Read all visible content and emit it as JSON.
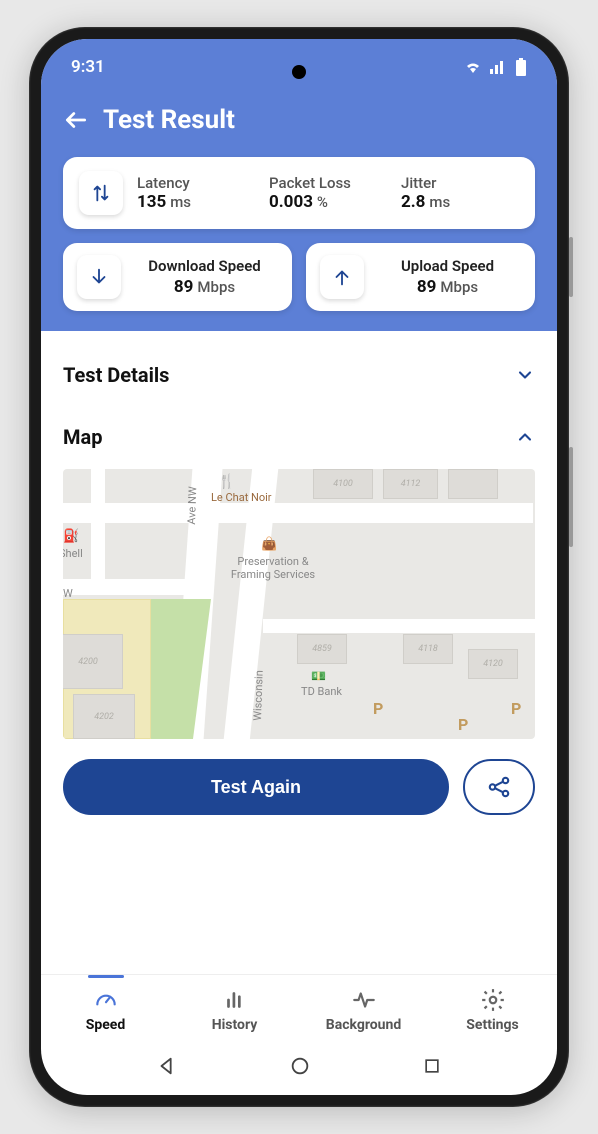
{
  "status": {
    "time": "9:31"
  },
  "header": {
    "title": "Test Result"
  },
  "stats": {
    "latency_label": "Latency",
    "latency_value": "135",
    "latency_unit": "ms",
    "packetloss_label": "Packet Loss",
    "packetloss_value": "0.003",
    "packetloss_unit": "%",
    "jitter_label": "Jitter",
    "jitter_value": "2.8",
    "jitter_unit": "ms"
  },
  "speed": {
    "download_label": "Download Speed",
    "download_value": "89",
    "download_unit": "Mbps",
    "upload_label": "Upload Speed",
    "upload_value": "89",
    "upload_unit": "Mbps"
  },
  "sections": {
    "details_title": "Test Details",
    "map_title": "Map"
  },
  "map": {
    "road1": "Ave NW",
    "road2": "Wisconsin",
    "poi1": "Le Chat Noir",
    "poi2": "Preservation & Framing Services",
    "poi3": "TD Bank",
    "poi4": "Shell",
    "b1": "4200",
    "b2": "4202",
    "b3": "4859",
    "b4": "4100",
    "b5": "4112",
    "b6": "4118",
    "b7": "4120",
    "p": "P"
  },
  "actions": {
    "test_again": "Test Again"
  },
  "nav": {
    "speed": "Speed",
    "history": "History",
    "background": "Background",
    "settings": "Settings"
  }
}
